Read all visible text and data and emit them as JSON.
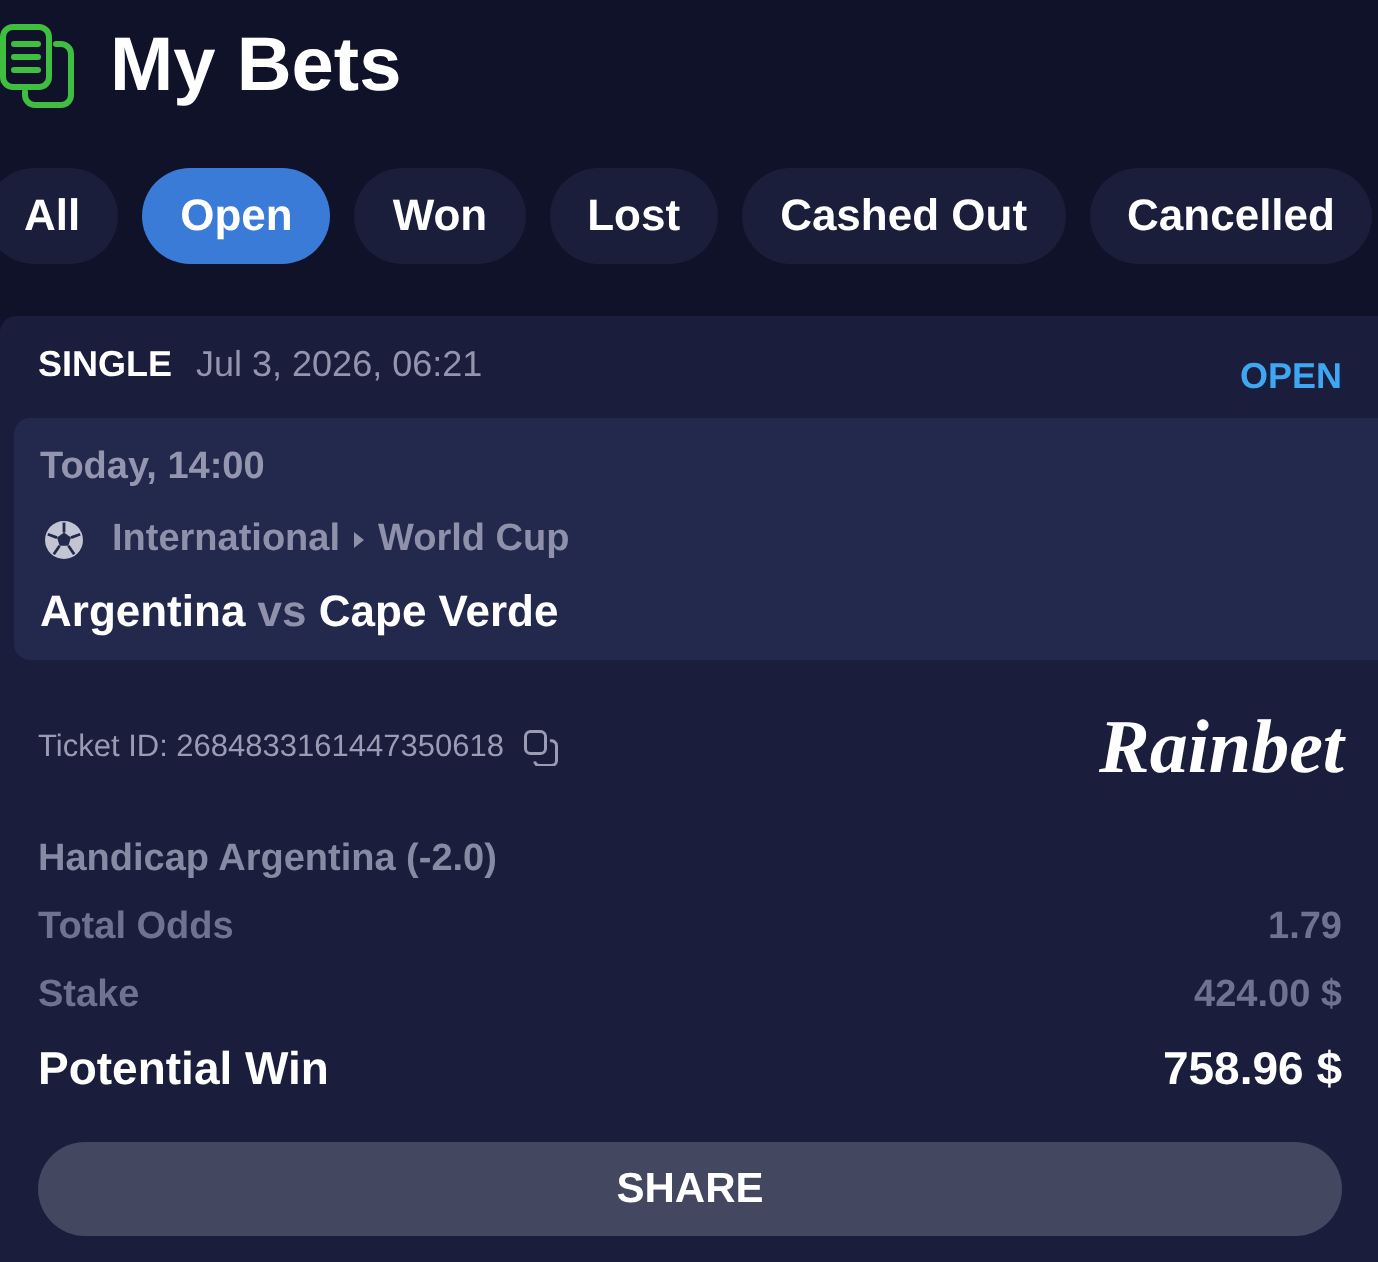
{
  "header": {
    "title": "My Bets"
  },
  "tabs": [
    {
      "label": "All",
      "selected": false
    },
    {
      "label": "Open",
      "selected": true
    },
    {
      "label": "Won",
      "selected": false
    },
    {
      "label": "Lost",
      "selected": false
    },
    {
      "label": "Cashed Out",
      "selected": false
    },
    {
      "label": "Cancelled",
      "selected": false
    }
  ],
  "bet": {
    "type": "SINGLE",
    "placed": "Jul 3, 2026, 06:21",
    "status": "OPEN",
    "event": {
      "time": "Today, 14:00",
      "category": "International",
      "league": "World Cup",
      "home": "Argentina",
      "separator": "vs",
      "away": "Cape Verde"
    },
    "ticket": "Ticket ID: 2684833161447350618",
    "brand": "Rainbet",
    "selection": "Handicap Argentina (-2.0)",
    "summary": [
      {
        "label": "Total Odds",
        "value": "1.79",
        "kind": "muted"
      },
      {
        "label": "Stake",
        "value": "424.00 $",
        "kind": "muted"
      },
      {
        "label": "Potential Win",
        "value": "758.96 $",
        "kind": "highlight"
      }
    ],
    "share_button": "SHARE"
  }
}
